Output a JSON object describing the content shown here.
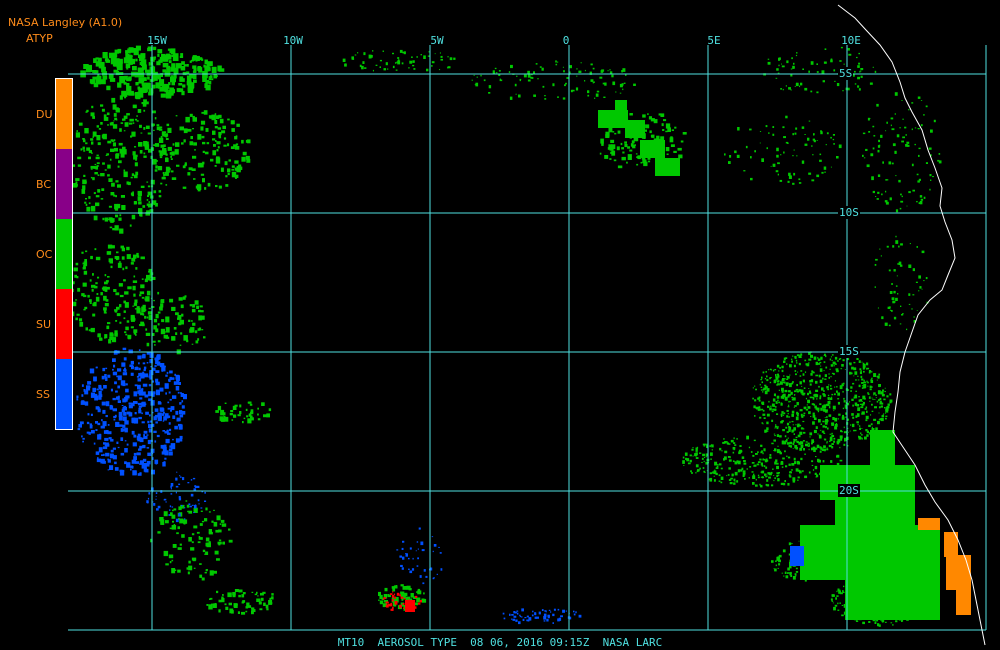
{
  "header": {
    "source": "NASA Langley (A1.0)",
    "product": "ATYP"
  },
  "legend": [
    {
      "code": "DU",
      "color": "#ff8800"
    },
    {
      "code": "BC",
      "color": "#880088"
    },
    {
      "code": "OC",
      "color": "#00c800"
    },
    {
      "code": "SU",
      "color": "#ff0000"
    },
    {
      "code": "SS",
      "color": "#0050ff"
    }
  ],
  "longitude_labels": [
    "15W",
    "10W",
    "5W",
    "0",
    "5E",
    "10E"
  ],
  "latitude_labels": [
    "5S",
    "10S",
    "15S",
    "20S"
  ],
  "footer": "MT10  AEROSOL TYPE  08 06, 2016 09:15Z  NASA LARC",
  "colors": {
    "grid": "#4fe0e0",
    "coastline": "#ffffff",
    "background": "#000000"
  }
}
